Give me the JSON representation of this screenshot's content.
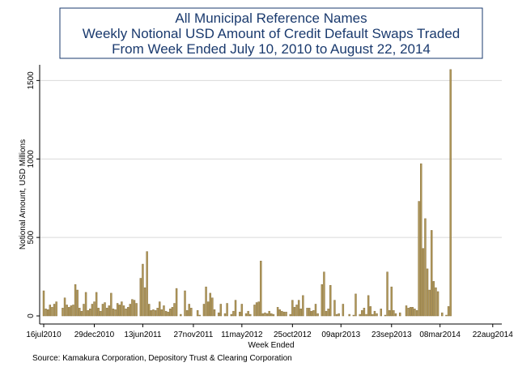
{
  "chart_data": {
    "type": "bar",
    "title_lines": [
      "All Municipal Reference Names",
      "Weekly Notional USD Amount of Credit Default Swaps Traded",
      "From Week Ended July 10, 2010 to August 22, 2014"
    ],
    "xlabel": "Week Ended",
    "ylabel": "Notional Amount, USD Millions",
    "source": "Source: Kamakura Corporation, Depository Trust & Clearing Corporation",
    "ylim": [
      0,
      1600
    ],
    "yticks": [
      0,
      500,
      1000,
      1500
    ],
    "grid": true,
    "bar_color": "#b0975a",
    "week_count": 216,
    "x_tick_labels": [
      {
        "label": "16jul2010",
        "week": 1
      },
      {
        "label": "29dec2010",
        "week": 25
      },
      {
        "label": "13jun2011",
        "week": 48
      },
      {
        "label": "27nov2011",
        "week": 72
      },
      {
        "label": "11may2012",
        "week": 95
      },
      {
        "label": "25oct2012",
        "week": 119
      },
      {
        "label": "09apr2013",
        "week": 142
      },
      {
        "label": "23sep2013",
        "week": 166
      },
      {
        "label": "08mar2014",
        "week": 189
      },
      {
        "label": "22aug2014",
        "week": 214
      }
    ],
    "values": [
      160,
      45,
      40,
      70,
      55,
      75,
      90,
      0,
      0,
      50,
      115,
      70,
      55,
      65,
      70,
      200,
      165,
      50,
      30,
      75,
      150,
      35,
      45,
      75,
      90,
      150,
      50,
      30,
      75,
      85,
      50,
      65,
      145,
      45,
      40,
      80,
      70,
      90,
      65,
      45,
      55,
      75,
      105,
      100,
      80,
      0,
      240,
      330,
      180,
      410,
      75,
      35,
      40,
      35,
      50,
      90,
      40,
      65,
      30,
      25,
      45,
      55,
      80,
      175,
      0,
      10,
      0,
      160,
      35,
      75,
      50,
      0,
      0,
      35,
      5,
      0,
      75,
      185,
      90,
      145,
      115,
      40,
      0,
      20,
      75,
      0,
      15,
      80,
      0,
      10,
      30,
      100,
      0,
      25,
      75,
      0,
      15,
      30,
      10,
      0,
      70,
      85,
      90,
      350,
      15,
      20,
      15,
      30,
      15,
      10,
      0,
      55,
      40,
      30,
      25,
      25,
      0,
      10,
      100,
      55,
      70,
      100,
      45,
      130,
      0,
      50,
      50,
      30,
      35,
      75,
      15,
      0,
      200,
      280,
      30,
      45,
      195,
      0,
      100,
      10,
      15,
      0,
      75,
      0,
      0,
      10,
      0,
      5,
      140,
      0,
      10,
      35,
      50,
      10,
      130,
      60,
      10,
      30,
      15,
      0,
      45,
      0,
      5,
      280,
      35,
      185,
      35,
      15,
      0,
      20,
      0,
      0,
      65,
      50,
      55,
      55,
      45,
      35,
      730,
      970,
      430,
      620,
      300,
      165,
      545,
      220,
      180,
      155,
      0,
      20,
      0,
      5,
      60,
      1570
    ]
  }
}
